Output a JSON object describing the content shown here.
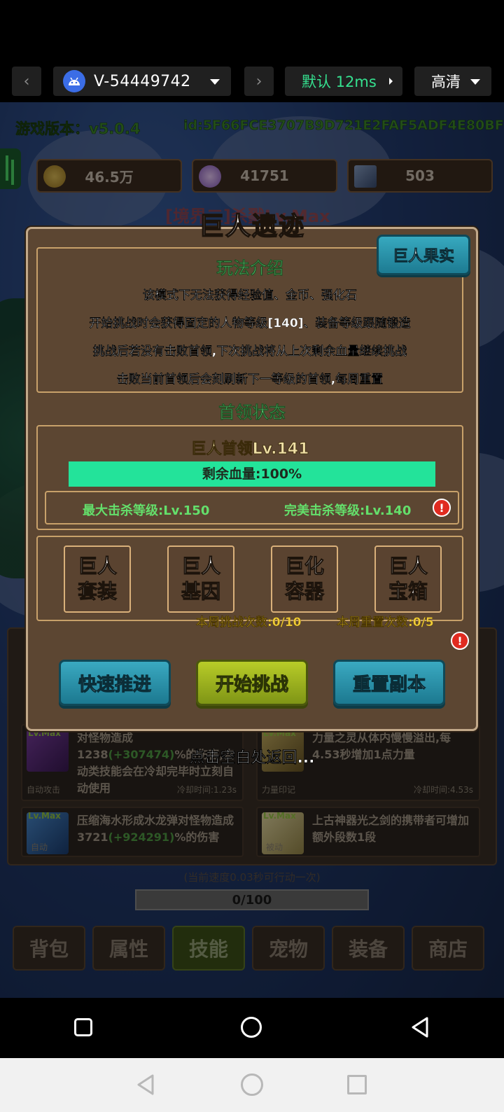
{
  "toolbar": {
    "back_icon": "chevron-left-icon",
    "device_id": "V-54449742",
    "forward_icon": "chevron-right-icon",
    "latency": "默认 12ms",
    "quality": "高清"
  },
  "game": {
    "version": "游戏版本：v5.0.4",
    "player_id": "id:5F66FCE3707B9D721E2FAF5ADF4E80BF",
    "resources": [
      {
        "icon": "coin-icon",
        "value": "46.5万"
      },
      {
        "icon": "crystal-icon",
        "value": "41751"
      },
      {
        "icon": "card-icon",
        "value": "503"
      }
    ],
    "realm_title": "[境界二]杀戮Lv.Max",
    "skills": [
      {
        "level": "Lv.Max",
        "desc_a": "对怪物造成1238",
        "desc_b": "(+307474)",
        "desc_c": "%的伤害,自动类技能会在冷却完毕时立刻自动使用",
        "type": "自动攻击",
        "cooldown": "冷却时间:1.23s"
      },
      {
        "level": "Lv.Max",
        "desc_a": "力量之灵从体内慢慢溢出,每4.53秒增加1点力量",
        "desc_b": "",
        "desc_c": "",
        "type": "力量印记",
        "cooldown": "冷却时间:4.53s"
      },
      {
        "level": "Lv.Max",
        "desc_a": "压缩海水形成水龙弹对怪物造成3721",
        "desc_b": "(+924291)",
        "desc_c": "%的伤害",
        "type": "自动",
        "cooldown": ""
      },
      {
        "level": "Lv.Max",
        "desc_a": "上古神器光之剑的携带者可增加额外段数1段",
        "desc_b": "",
        "desc_c": "",
        "type": "被动",
        "cooldown": ""
      }
    ],
    "speed_text": "(当前速度0.03秒可行动一次)",
    "progress": "0/100",
    "tabs": [
      "背包",
      "属性",
      "技能",
      "宠物",
      "装备",
      "商店"
    ],
    "active_tab": "技能"
  },
  "modal": {
    "title": "巨人遗迹",
    "fruit_button": "巨人果实",
    "intro_heading": "玩法介绍",
    "intro_lines": [
      "该模式下无法获得经验值、金币、强化石",
      "开始挑战时会获得固定的人物等级[140]、装备等级跟随锻造",
      "挑战后若没有击败首领,下次挑战将从上次剩余血量继续挑战",
      "击败当前首领后会刻刷新下一等级的首领,每周重置"
    ],
    "status_heading": "首领状态",
    "boss_name": "巨人首领Lv.141",
    "hp_text": "剩余血量:100%",
    "hp_fraction": 1.0,
    "max_kill": "最大击杀等级:Lv.150",
    "perfect_kill": "完美击杀等级:Lv.140",
    "alert_symbol": "!",
    "features": [
      {
        "line1": "巨人",
        "line2": "套装"
      },
      {
        "line1": "巨人",
        "line2": "基因"
      },
      {
        "line1": "巨化",
        "line2": "容器"
      },
      {
        "line1": "巨人",
        "line2": "宝箱"
      }
    ],
    "weekly_challenges": "本周挑战次数:0/10",
    "weekly_resets": "本周重置次数:0/5",
    "buttons": {
      "fast": "快速推进",
      "start": "开始挑战",
      "reset": "重置副本"
    },
    "return_hint": "点击空白处返回..."
  },
  "colors": {
    "hp": "#23e39a",
    "accent_green": "#5ed07a",
    "gold": "#f0cc37",
    "blue_btn": "#2a93ab",
    "green_btn": "#9cb11f"
  }
}
